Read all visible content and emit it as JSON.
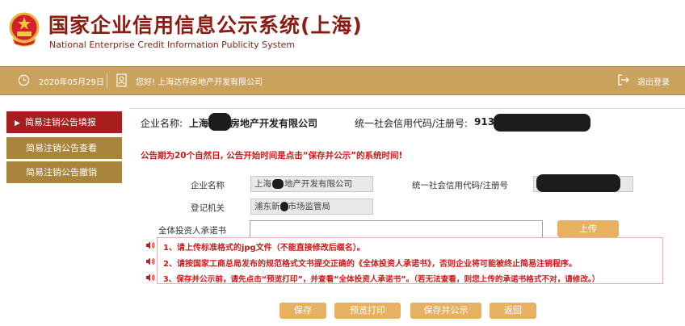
{
  "header": {
    "title": "国家企业信用信息公示系统(上海)",
    "subtitle": "National Enterprise Credit Information Publicity System",
    "emblem_icon": "national-emblem-icon"
  },
  "infobar": {
    "date": "2020年05月29日",
    "greeting": "您好! 上海达存房地产开发有限公司",
    "logout": "退出登录"
  },
  "sidebar": {
    "items": [
      {
        "label": "简易注销公告填报",
        "active": true
      },
      {
        "label": "简易注销公告查看",
        "active": false
      },
      {
        "label": "简易注销公告撤销",
        "active": false
      }
    ]
  },
  "main": {
    "company_label": "企业名称:",
    "company_name_start": "上海",
    "company_name_end": "房地产开发有限公司",
    "credit_label": "统一社会信用代码/注册号:",
    "credit_code_start": "913",
    "notice": "公告期为20个自然日, 公告开始时间是点击“保存并公示”的系统时间!",
    "form": {
      "name_label": "企业名称",
      "name_value_start": "上海",
      "name_value_end": "地产开发有限公司",
      "code_label": "统一社会信用代码/注册号",
      "authority_label": "登记机关",
      "authority_value_start": "浦东新",
      "authority_value_end": "市场监管局",
      "commit_label": "全体投资人承诺书",
      "commit_value": "",
      "upload_label": "上传"
    },
    "instructions": [
      "1、请上传标准格式的jpg文件（不能直接修改后缀名）。",
      "2、请按国家工商总局发布的规范格式文书提交正确的《全体投资人承诺书》，否则企业将可能被终止简易注销程序。",
      "3、保存并公示前，请先点击“预览打印”，并查看“全体投资人承诺书”。（若无法查看，则您上传的承诺书格式不对，请修改。）"
    ],
    "buttons": {
      "save": "保存",
      "preview": "预览打印",
      "publish": "保存并公示",
      "back": "返回"
    }
  },
  "colors": {
    "brand_red": "#8b1c12",
    "infobar_gold": "#c9a25e",
    "sidebar_active": "#a81e1e",
    "sidebar_normal": "#a8843d",
    "button_orange": "#e8b061",
    "notice_red": "#d11919"
  }
}
